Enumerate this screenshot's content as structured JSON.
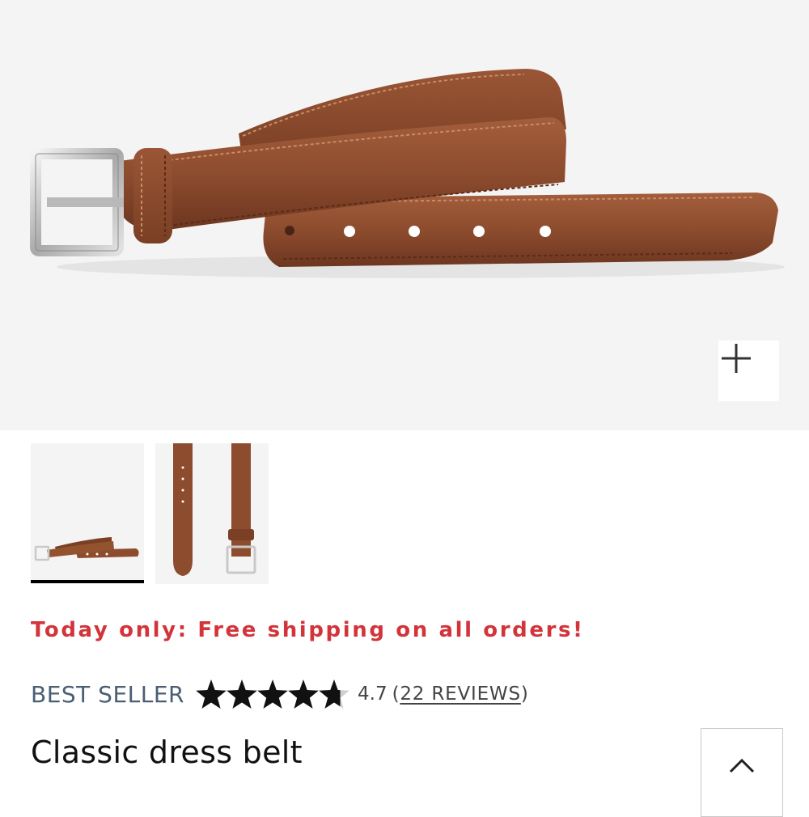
{
  "promo": {
    "text": "Today only: Free shipping on all orders!",
    "color": "#d2343a"
  },
  "product": {
    "badge": "BEST SELLER",
    "badge_color": "#4a5e74",
    "rating": {
      "value": 4.7,
      "max": 5,
      "display": "4.7"
    },
    "reviews": {
      "open": "(",
      "label": "22 REVIEWS",
      "close": ")"
    },
    "title": "Classic dress belt"
  },
  "gallery": {
    "thumbnails": [
      {
        "name": "belt-coiled-view",
        "selected": true
      },
      {
        "name": "belt-flat-view",
        "selected": false
      }
    ]
  },
  "icons": {
    "zoom": "plus-icon",
    "back_to_top": "chevron-up-icon",
    "rating": "star-icon"
  },
  "colors": {
    "leather": "#8a4a2c",
    "background": "#f4f4f4",
    "text": "#111111"
  }
}
